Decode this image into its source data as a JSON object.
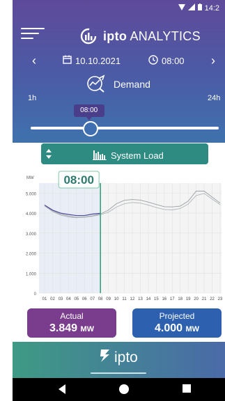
{
  "status": {
    "time": "14:2"
  },
  "app": {
    "title_bold": "ipto",
    "title_rest": "ANALYTICS"
  },
  "date_nav": {
    "date": "10.10.2021",
    "time": "08:00"
  },
  "mode": {
    "label": "Demand"
  },
  "slider": {
    "min_label": "1h",
    "max_label": "24h",
    "value_label": "08:00",
    "value_fraction": 0.31
  },
  "load_button": {
    "label": "System Load"
  },
  "chart_data": {
    "type": "line",
    "ylabel": "MW",
    "ylim": [
      0,
      5500
    ],
    "yticks": [
      "0",
      "1.000",
      "2.000",
      "3.000",
      "4.000",
      "5.000"
    ],
    "x": [
      "01",
      "02",
      "03",
      "04",
      "05",
      "06",
      "07",
      "08",
      "09",
      "10",
      "11",
      "12",
      "13",
      "14",
      "15",
      "16",
      "17",
      "18",
      "19",
      "20",
      "21",
      "22",
      "23"
    ],
    "current_hour_label": "08:00",
    "series": [
      {
        "values": [
          4400,
          4150,
          4000,
          3930,
          3880,
          3880,
          3950,
          3990
        ],
        "color": "#4b4a9a"
      },
      {
        "values": [
          4400,
          4100,
          3950,
          3850,
          3790,
          3810,
          3860,
          3960,
          4150,
          4470,
          4640,
          4680,
          4650,
          4550,
          4430,
          4320,
          4310,
          4350,
          4600,
          5100,
          5100,
          4800,
          4500
        ],
        "color": "#9aa0a6"
      },
      {
        "values": [
          4350,
          4080,
          3900,
          3800,
          3770,
          3790,
          3840,
          3920,
          4050,
          4300,
          4470,
          4530,
          4500,
          4400,
          4280,
          4180,
          4160,
          4230,
          4450,
          4880,
          4980,
          4700,
          4420
        ],
        "color": "#b0b6bb"
      }
    ]
  },
  "cards": {
    "actual": {
      "title": "Actual",
      "value": "3.849",
      "unit": "MW",
      "color": "#7a3d8e"
    },
    "projected": {
      "title": "Projected",
      "value": "4.000",
      "unit": "MW",
      "color": "#2d61b0"
    }
  },
  "footer": {
    "brand": "ipto"
  }
}
